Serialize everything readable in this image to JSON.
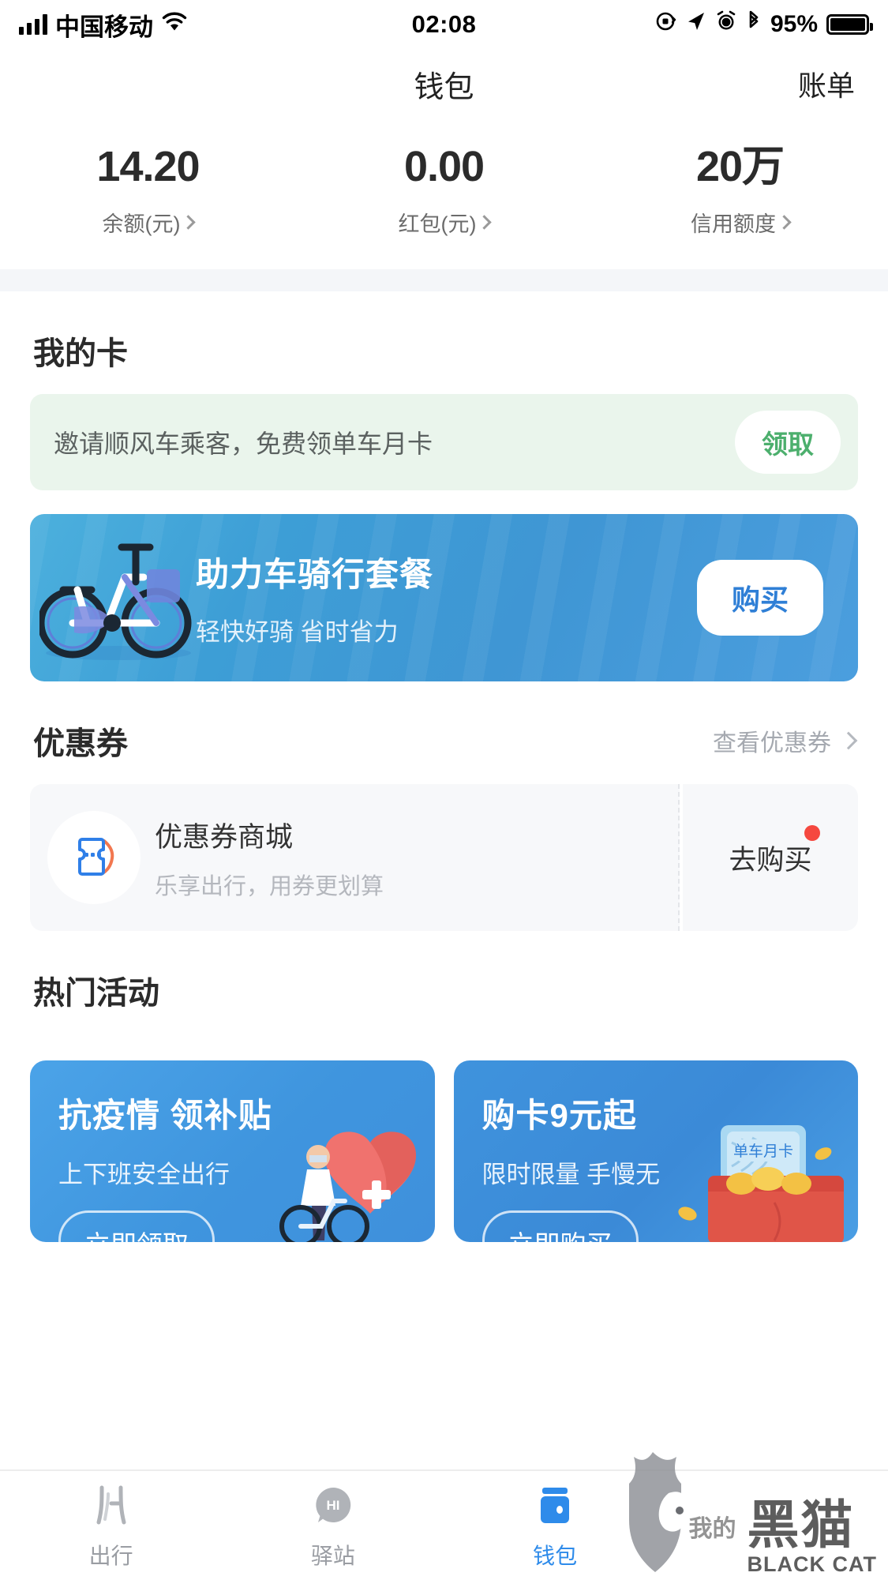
{
  "status_bar": {
    "carrier": "中国移动",
    "time": "02:08",
    "battery_pct": "95%",
    "icons": [
      "signal-bars-icon",
      "wifi-icon",
      "rotation-lock-icon",
      "location-arrow-icon",
      "alarm-clock-icon",
      "bluetooth-icon",
      "battery-icon"
    ]
  },
  "nav": {
    "title": "钱包",
    "right_action": "账单"
  },
  "stats": [
    {
      "value": "14.20",
      "label": "余额(元)"
    },
    {
      "value": "0.00",
      "label": "红包(元)"
    },
    {
      "value": "20万",
      "label": "信用额度"
    }
  ],
  "my_card": {
    "section_title": "我的卡",
    "invite": {
      "text": "邀请顺风车乘客，免费领单车月卡",
      "button": "领取",
      "bg_color": "#eaf5ec",
      "button_text_color": "#4caf6d"
    },
    "ebike": {
      "title": "助力车骑行套餐",
      "subtitle": "轻快好骑 省时省力",
      "button": "购买",
      "bg_color": "#3f96d4",
      "button_text_color": "#2f7fd6"
    }
  },
  "coupon": {
    "section_title": "优惠券",
    "section_link": "查看优惠券",
    "item_title": "优惠券商城",
    "item_sub": "乐享出行，用券更划算",
    "action": "去购买",
    "badge_color": "#f5483f"
  },
  "activities": {
    "section_title": "热门活动",
    "items": [
      {
        "title": "抗疫情 领补贴",
        "subtitle": "上下班安全出行",
        "button": "立即领取"
      },
      {
        "title": "购卡9元起",
        "subtitle": "限时限量 手慢无",
        "button": "立即购买",
        "card_tag": "单车月卡"
      }
    ]
  },
  "tabbar": {
    "items": [
      {
        "label": "出行",
        "icon": "road-icon",
        "active": false
      },
      {
        "label": "驿站",
        "icon": "hi-bubble-icon",
        "active": false
      },
      {
        "label": "钱包",
        "icon": "wallet-icon",
        "active": true
      }
    ],
    "active_color": "#2e8bea"
  },
  "watermark": {
    "cn": "黑猫",
    "en": "BLACK CAT",
    "sub": "我的"
  }
}
